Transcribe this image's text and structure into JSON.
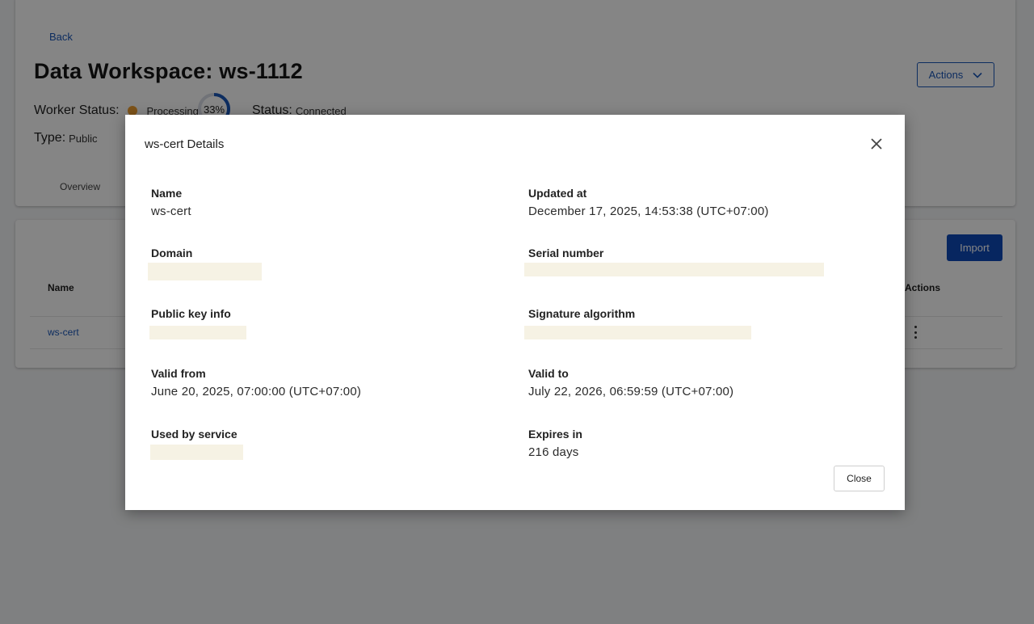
{
  "page": {
    "back_label": "Back",
    "title": "Data Workspace: ws-1112",
    "actions_label": "Actions",
    "worker_status_label": "Worker Status:",
    "worker_status_value": "Processing",
    "progress_percent": 33,
    "progress_label": "33%",
    "status_label": "Status:",
    "status_value": "Connected",
    "type_label": "Type:",
    "type_value": "Public",
    "tabs": [
      {
        "label": "Overview"
      }
    ]
  },
  "table": {
    "import_label": "Import",
    "columns": {
      "name": "Name",
      "actions": "Actions"
    },
    "rows": [
      {
        "name": "ws-cert"
      }
    ]
  },
  "modal": {
    "title": "ws-cert Details",
    "fields": {
      "name": {
        "label": "Name",
        "value": "ws-cert"
      },
      "updated_at": {
        "label": "Updated at",
        "value": "December 17, 2025, 14:53:38 (UTC+07:00)"
      },
      "domain": {
        "label": "Domain",
        "value": ""
      },
      "serial_number": {
        "label": "Serial number",
        "value": ""
      },
      "public_key_info": {
        "label": "Public key info",
        "value": ""
      },
      "signature_algorithm": {
        "label": "Signature algorithm",
        "value": ""
      },
      "valid_from": {
        "label": "Valid from",
        "value": "June 20, 2025, 07:00:00 (UTC+07:00)"
      },
      "valid_to": {
        "label": "Valid to",
        "value": "July 22, 2026, 06:59:59 (UTC+07:00)"
      },
      "used_by_service": {
        "label": "Used by service",
        "value": ""
      },
      "expires_in": {
        "label": "Expires in",
        "value": "216 days"
      }
    },
    "close_label": "Close"
  },
  "colors": {
    "accent": "#1a56b8",
    "primary_button": "#0f4ab8",
    "status_dot": "#f0a030",
    "redacted": "#f6f2e4"
  },
  "icons": {
    "dropdown": "chevron-down-icon",
    "close": "close-icon",
    "row_menu": "kebab-menu-icon",
    "worker_status": "status-dot-icon"
  }
}
